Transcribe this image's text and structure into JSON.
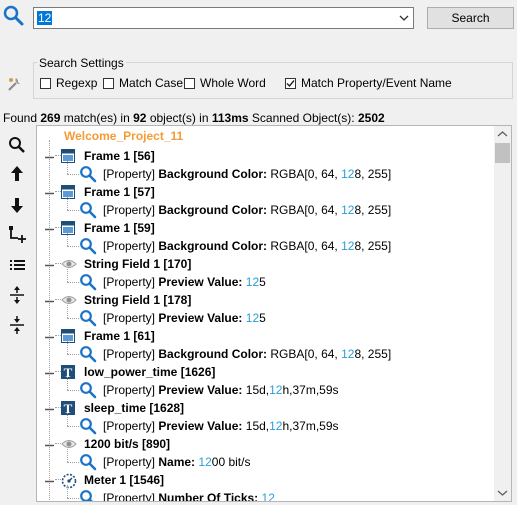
{
  "search": {
    "query": "12",
    "button_label": "Search"
  },
  "settings": {
    "legend": "Search Settings",
    "options": [
      {
        "label": "Regexp",
        "checked": false
      },
      {
        "label": "Match Case",
        "checked": false
      },
      {
        "label": "Whole Word",
        "checked": false
      },
      {
        "label": "Match Property/Event Name",
        "checked": true
      }
    ]
  },
  "stats": {
    "found_prefix": "Found",
    "matches": "269",
    "matches_suffix": "match(es) in",
    "objects": "92",
    "objects_suffix": "object(s) in",
    "time": "113ms",
    "scanned_label": "Scanned Object(s):",
    "scanned": "2502"
  },
  "toolbar": [
    "search-icon",
    "arrow-up-icon",
    "arrow-down-icon",
    "add-node-icon",
    "list-icon",
    "expand-all-icon",
    "collapse-all-icon"
  ],
  "tree": {
    "root": "Welcome_Project_11",
    "nodes": [
      {
        "icon": "frame-icon",
        "label": "Frame 1 [56]",
        "prop_tag": "[Property]",
        "prop_name": "Background Color:",
        "pre": "RGBA[0, 64, ",
        "hl": "12",
        "post": "8, 255]"
      },
      {
        "icon": "frame-icon",
        "label": "Frame 1 [57]",
        "prop_tag": "[Property]",
        "prop_name": "Background Color:",
        "pre": "RGBA[0, 64, ",
        "hl": "12",
        "post": "8, 255]"
      },
      {
        "icon": "frame-icon",
        "label": "Frame 1 [59]",
        "prop_tag": "[Property]",
        "prop_name": "Background Color:",
        "pre": "RGBA[0, 64, ",
        "hl": "12",
        "post": "8, 255]"
      },
      {
        "icon": "eye-icon",
        "label": "String Field 1 [170]",
        "prop_tag": "[Property]",
        "prop_name": "Preview Value:",
        "pre": "",
        "hl": "12",
        "post": "5"
      },
      {
        "icon": "eye-icon",
        "label": "String Field 1 [178]",
        "prop_tag": "[Property]",
        "prop_name": "Preview Value:",
        "pre": "",
        "hl": "12",
        "post": "5"
      },
      {
        "icon": "frame-icon",
        "label": "Frame 1 [61]",
        "prop_tag": "[Property]",
        "prop_name": "Background Color:",
        "pre": "RGBA[0, 64, ",
        "hl": "12",
        "post": "8, 255]"
      },
      {
        "icon": "text-t-icon",
        "label": "low_power_time [1626]",
        "prop_tag": "[Property]",
        "prop_name": "Preview Value:",
        "pre": "15d,",
        "hl": "12",
        "post": "h,37m,59s"
      },
      {
        "icon": "text-t-icon",
        "label": "sleep_time [1628]",
        "prop_tag": "[Property]",
        "prop_name": "Preview Value:",
        "pre": "15d,",
        "hl": "12",
        "post": "h,37m,59s"
      },
      {
        "icon": "eye-icon",
        "label": "1200 bit/s [890]",
        "prop_tag": "[Property]",
        "prop_name": "Name:",
        "pre": "",
        "hl": "12",
        "post": "00 bit/s"
      },
      {
        "icon": "meter-icon",
        "label": "Meter 1 [1546]",
        "prop_tag": "[Property]",
        "prop_name": "Number Of Ticks:",
        "pre": "",
        "hl": "12",
        "post": ""
      }
    ]
  }
}
